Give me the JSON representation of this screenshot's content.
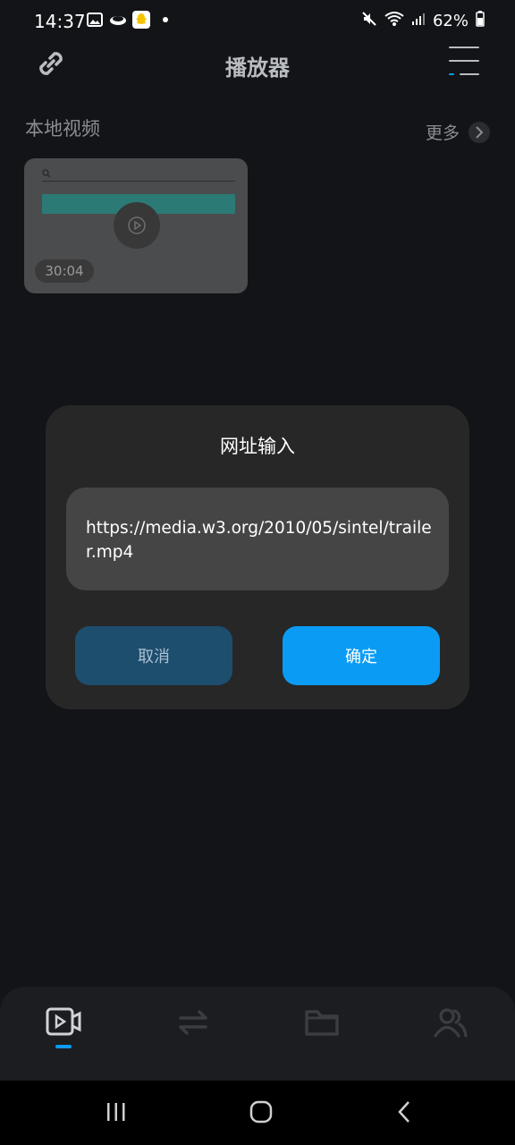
{
  "status_bar": {
    "time": "14:37",
    "battery": "62%",
    "left_icons": [
      "gallery-icon",
      "cloud-icon",
      "snapchat-icon"
    ],
    "right_icons": [
      "mute-icon",
      "wifi-icon",
      "signal-icon",
      "battery-icon"
    ]
  },
  "app_bar": {
    "title": "播放器"
  },
  "section": {
    "title": "本地视频",
    "more_label": "更多"
  },
  "video": {
    "duration": "30:04"
  },
  "dialog": {
    "title": "网址输入",
    "url_value": "https://media.w3.org/2010/05/sintel/trailer.mp4",
    "cancel_label": "取消",
    "confirm_label": "确定"
  },
  "bottom_nav": {
    "items": [
      "video-player-icon",
      "transfer-icon",
      "folder-icon",
      "users-icon"
    ],
    "active_index": 0
  },
  "colors": {
    "accent": "#0a9cf5",
    "background": "#121417",
    "dialog": "#272727"
  }
}
